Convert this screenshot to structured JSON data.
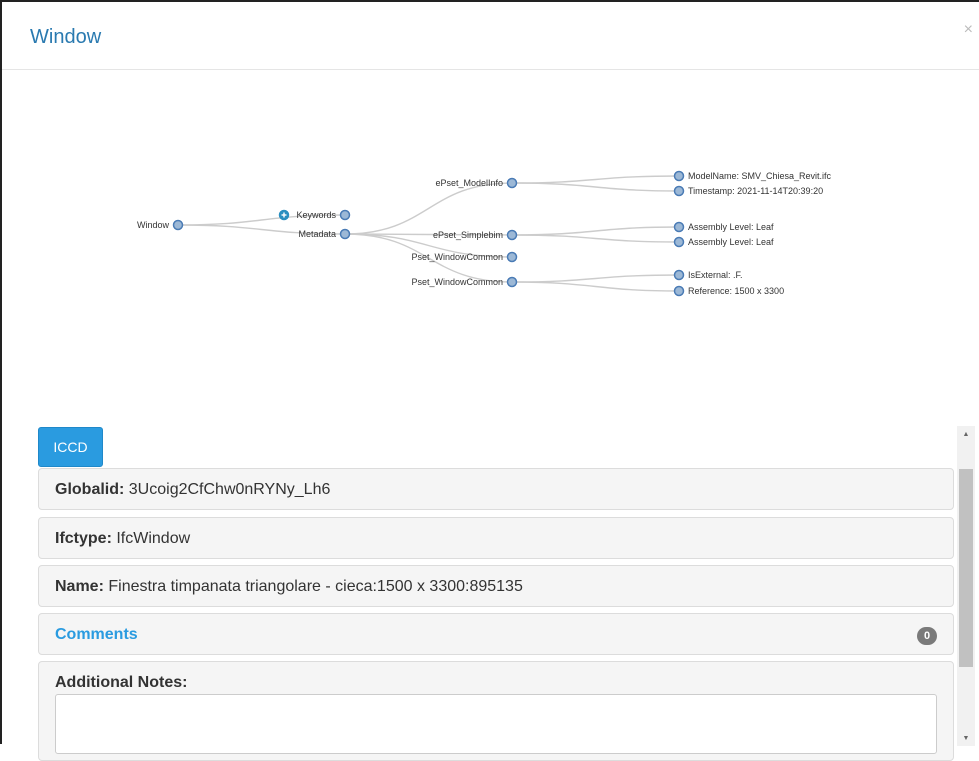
{
  "modal": {
    "title": "Window",
    "close_label": "×"
  },
  "tree": {
    "root": "Window",
    "level1": [
      "Keywords",
      "Metadata"
    ],
    "level2": [
      "ePset_ModelInfo",
      "ePset_Simplebim",
      "Pset_WindowCommon",
      "Pset_WindowCommon"
    ],
    "level3": [
      "ModelName: SMV_Chiesa_Revit.ifc",
      "Timestamp: 2021-11-14T20:39:20",
      "Assembly Level: Leaf",
      "Assembly Level: Leaf",
      "IsExternal: .F.",
      "Reference: 1500 x 3300"
    ]
  },
  "icc_button": "ICCD",
  "fields": {
    "globalid_label": "Globalid:",
    "globalid_value": "3Ucoig2CfChw0nRYNy_Lh6",
    "ifctype_label": "Ifctype:",
    "ifctype_value": "IfcWindow",
    "name_label": "Name:",
    "name_value": "Finestra timpanata triangolare - cieca:1500 x 3300:895135"
  },
  "comments": {
    "label": "Comments",
    "count": "0"
  },
  "notes": {
    "label": "Additional Notes:",
    "value": ""
  },
  "scrollbar": {
    "up": "▲",
    "down": "▼"
  }
}
